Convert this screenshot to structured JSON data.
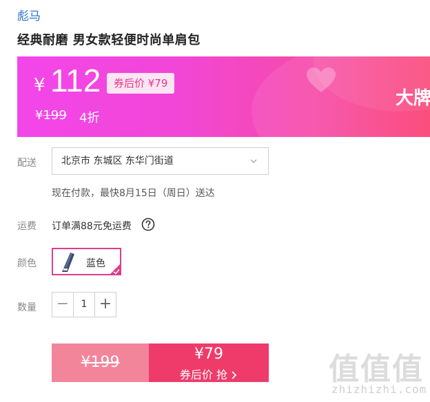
{
  "brand": "彪马",
  "product_title": "经典耐磨 男女款轻便时尚单肩包",
  "price": {
    "currency": "¥",
    "amount": "112",
    "coupon_label": "券后价 ¥79",
    "original_currency": "¥",
    "original_amount": "199",
    "discount": "4折",
    "promo_text": "大牌"
  },
  "delivery": {
    "label": "配送",
    "location": "北京市 东城区 东华门街道",
    "note": "现在付款，最快8月15日（周日）送达"
  },
  "shipping": {
    "label": "运费",
    "text": "订单满88元免运费"
  },
  "color": {
    "label": "颜色",
    "selected": "蓝色"
  },
  "quantity": {
    "label": "数量",
    "minus": "−",
    "value": "1",
    "plus": "+"
  },
  "buy": {
    "original": "¥199",
    "coupon_price": "¥79",
    "action": "券后价 抢"
  },
  "watermark": {
    "glyphs": "值值值",
    "domain": "zhizhizhi.com"
  },
  "icons": {
    "heart": "heart-icon",
    "chevron": "chevron-down-icon",
    "help": "question-icon",
    "check": "check-icon",
    "arrow": "chevron-right-icon"
  },
  "colors": {
    "brand_link": "#2a6fd6",
    "banner_start": "#f346ea",
    "banner_end": "#fb3f72",
    "selected_border": "#e03b8b",
    "buy_left": "#f3859a",
    "buy_right": "#ee3b6a"
  }
}
